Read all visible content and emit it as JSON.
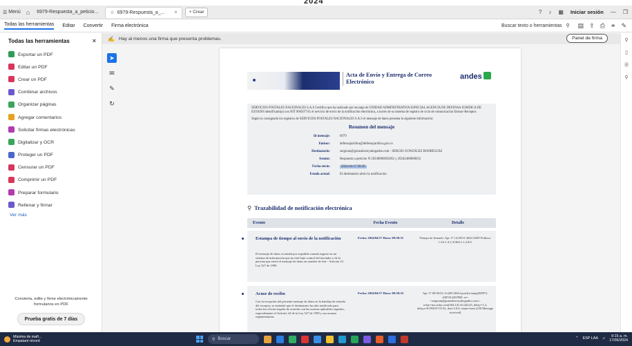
{
  "clock": {
    "year": "2024"
  },
  "titlebar": {
    "menu_label": "Menú",
    "tabs": [
      {
        "label": "6979-Respuesta_a_peticio..."
      },
      {
        "label": "6979-Respuesta_a_..."
      }
    ],
    "new_tab_label": "+ Crear",
    "signin_label": "Iniciar sesión"
  },
  "menubar": {
    "items": [
      "Todas las herramientas",
      "Editar",
      "Convertir",
      "Firma electrónica"
    ],
    "search_label": "Buscar texto o herramientas"
  },
  "leftpanel": {
    "title": "Todas las herramientas",
    "tools": [
      {
        "label": "Exportar un PDF",
        "color": "#2f9c5a"
      },
      {
        "label": "Editar un PDF",
        "color": "#d8365c"
      },
      {
        "label": "Crear un PDF",
        "color": "#d8365c"
      },
      {
        "label": "Combinar archivos",
        "color": "#6a5acd"
      },
      {
        "label": "Organizar páginas",
        "color": "#3aa55d"
      },
      {
        "label": "Agregar comentarios",
        "color": "#e6a21f"
      },
      {
        "label": "Solicitar firmas electrónicas",
        "color": "#b23bb0"
      },
      {
        "label": "Digitalizar y OCR",
        "color": "#3aa55d"
      },
      {
        "label": "Proteger un PDF",
        "color": "#4a68c8"
      },
      {
        "label": "Censurar un PDF",
        "color": "#d8365c"
      },
      {
        "label": "Comprimir un PDF",
        "color": "#d8365c"
      },
      {
        "label": "Preparar formulario",
        "color": "#b23bb0"
      },
      {
        "label": "Rellenar y firmar",
        "color": "#6a5acd"
      }
    ],
    "ver_mas": "Ver más",
    "promo": "Convierta, edite y firme electrónicamente formularios en PDF",
    "trial_button": "Prueba gratis de 7 días"
  },
  "infobar": {
    "message": "Hay al menos una firma que presenta problemas.",
    "panel_button": "Panel de firma"
  },
  "document": {
    "title": "Acta de Envío y Entrega de Correo Electrónico",
    "logo": "andes",
    "intro": "SERVICIOS POSTALES NACIONALES S.A.S Certifica que ha realizado por encargo de UNIDAD ADMINISTRATIVA ESPECIAL AGENCIA DE DEFENSA JURIDICA DE ESTADO identificado(a) con NIT 900507741 el servicio de envío de la notificación electrónica, a través de su sistema de registro de ciclo de comunicación Emisor-Receptor.",
    "intro2": "Según lo consignado los registros de SERVICIOS POSTALES NACIONALES S.A.S el mensaje de datos presenta la siguiente información:",
    "summary_title": "Resumen del mensaje",
    "summary": [
      {
        "key": "Id mensaje:",
        "value": "6979"
      },
      {
        "key": "Emisor:",
        "value": "defensajuridica@defensajuridica.gov.co"
      },
      {
        "key": "Destinatario:",
        "value": "sergioan@gonzalezreyabogados.com - SERGIO GONZÁLEZ RODRÍGUEZ"
      },
      {
        "key": "Asunto:",
        "value": "Respuesta a petición N 20248000058282 y 20242400068652"
      },
      {
        "key": "Fecha envío:",
        "value": "2024-04-17 09:58"
      },
      {
        "key": "Estado actual:",
        "value": "El destinatario abrio la notificacion"
      }
    ],
    "trace_title": "Trazabilidad de notificación electrónica",
    "table_headers": [
      "Evento",
      "Fecha Evento",
      "Detalle"
    ],
    "events": [
      {
        "title": "Estampa de tiempo al envío de la notificación",
        "desc": "El mensaje de datos se tendrá por expedido cuando ingrese en un sistema de información que no esté bajo control del iniciador o de la persona que envió el mensaje de datos en nombre de éste - Artículo 23 Ley 527 de 1999.",
        "date": "Fecha: 2024/04/17 Hora: 09:58:51",
        "detail": "Tiempo de firmado: Apr 17 14:58:51 2024 GMT Política: 1.3.6.1.4.1.31304.1.1.2.8.0."
      },
      {
        "title": "Acuse de recibo",
        "desc": "Con la recepción del presente mensaje de datos en la bandeja de entrada del receptor, se entiende que el destinatario ha sido notificado para todos los efectos legales de acuerdo con las normas aplicables vigentes, especialmente el Artículo 24 de la Ley 527 de 1999 y sus normas reglamentarias.",
        "date": "Fecha: 2024/04/17 Hora: 09:58:52",
        "detail": "Apr 17 09:58:52 cl-t205-282cl postfix/smtp[28597]: 4387412467BD: to=<sergioan@gonzalezreyabogados.com>, relay=mx.zoho.com[204.141.43.44]:25, delay=1.3, delays=0.09/0/0.7/0.52, dsn=2.0.0, status=sent (250 Message received)"
      }
    ]
  },
  "taskbar": {
    "weather_line1": "Máxima de mañ...",
    "weather_line2": "Empataré récord",
    "search_label": "Buscar",
    "lang": "ESP LAA",
    "time": "9:15 a. m.",
    "date": "17/06/2024"
  }
}
